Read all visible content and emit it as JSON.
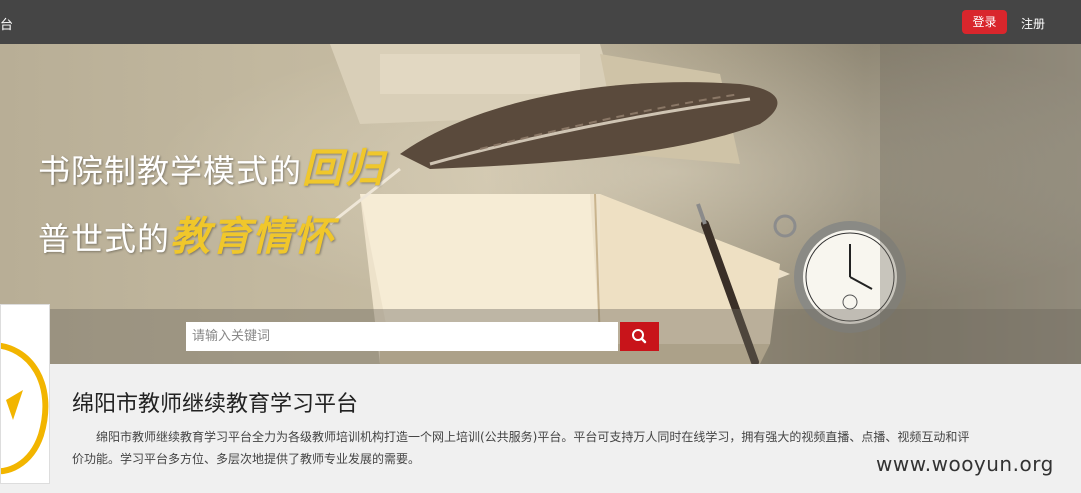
{
  "nav": {
    "left_fragment": "台",
    "login_label": "登录",
    "register_label": "注册"
  },
  "banner": {
    "line1_prefix": "书院制教学模式的",
    "line1_highlight": "回归",
    "line2_prefix": "普世式的",
    "line2_highlight": "教育情怀"
  },
  "search": {
    "placeholder": "请输入关键词",
    "icon": "search-icon"
  },
  "platform": {
    "title": "绵阳市教师继续教育学习平台",
    "description": "绵阳市教师继续教育学习平台全力为各级教师培训机构打造一个网上培训(公共服务)平台。平台可支持万人同时在线学习，拥有强大的视频直播、点播、视频互动和评价功能。学习平台多方位、多层次地提供了教师专业发展的需要。"
  },
  "watermark": "www.wooyun.org",
  "colors": {
    "nav_bg": "#454545",
    "accent_red": "#d9262c",
    "search_btn": "#c8141a",
    "highlight_gold": "#f0c72b"
  }
}
